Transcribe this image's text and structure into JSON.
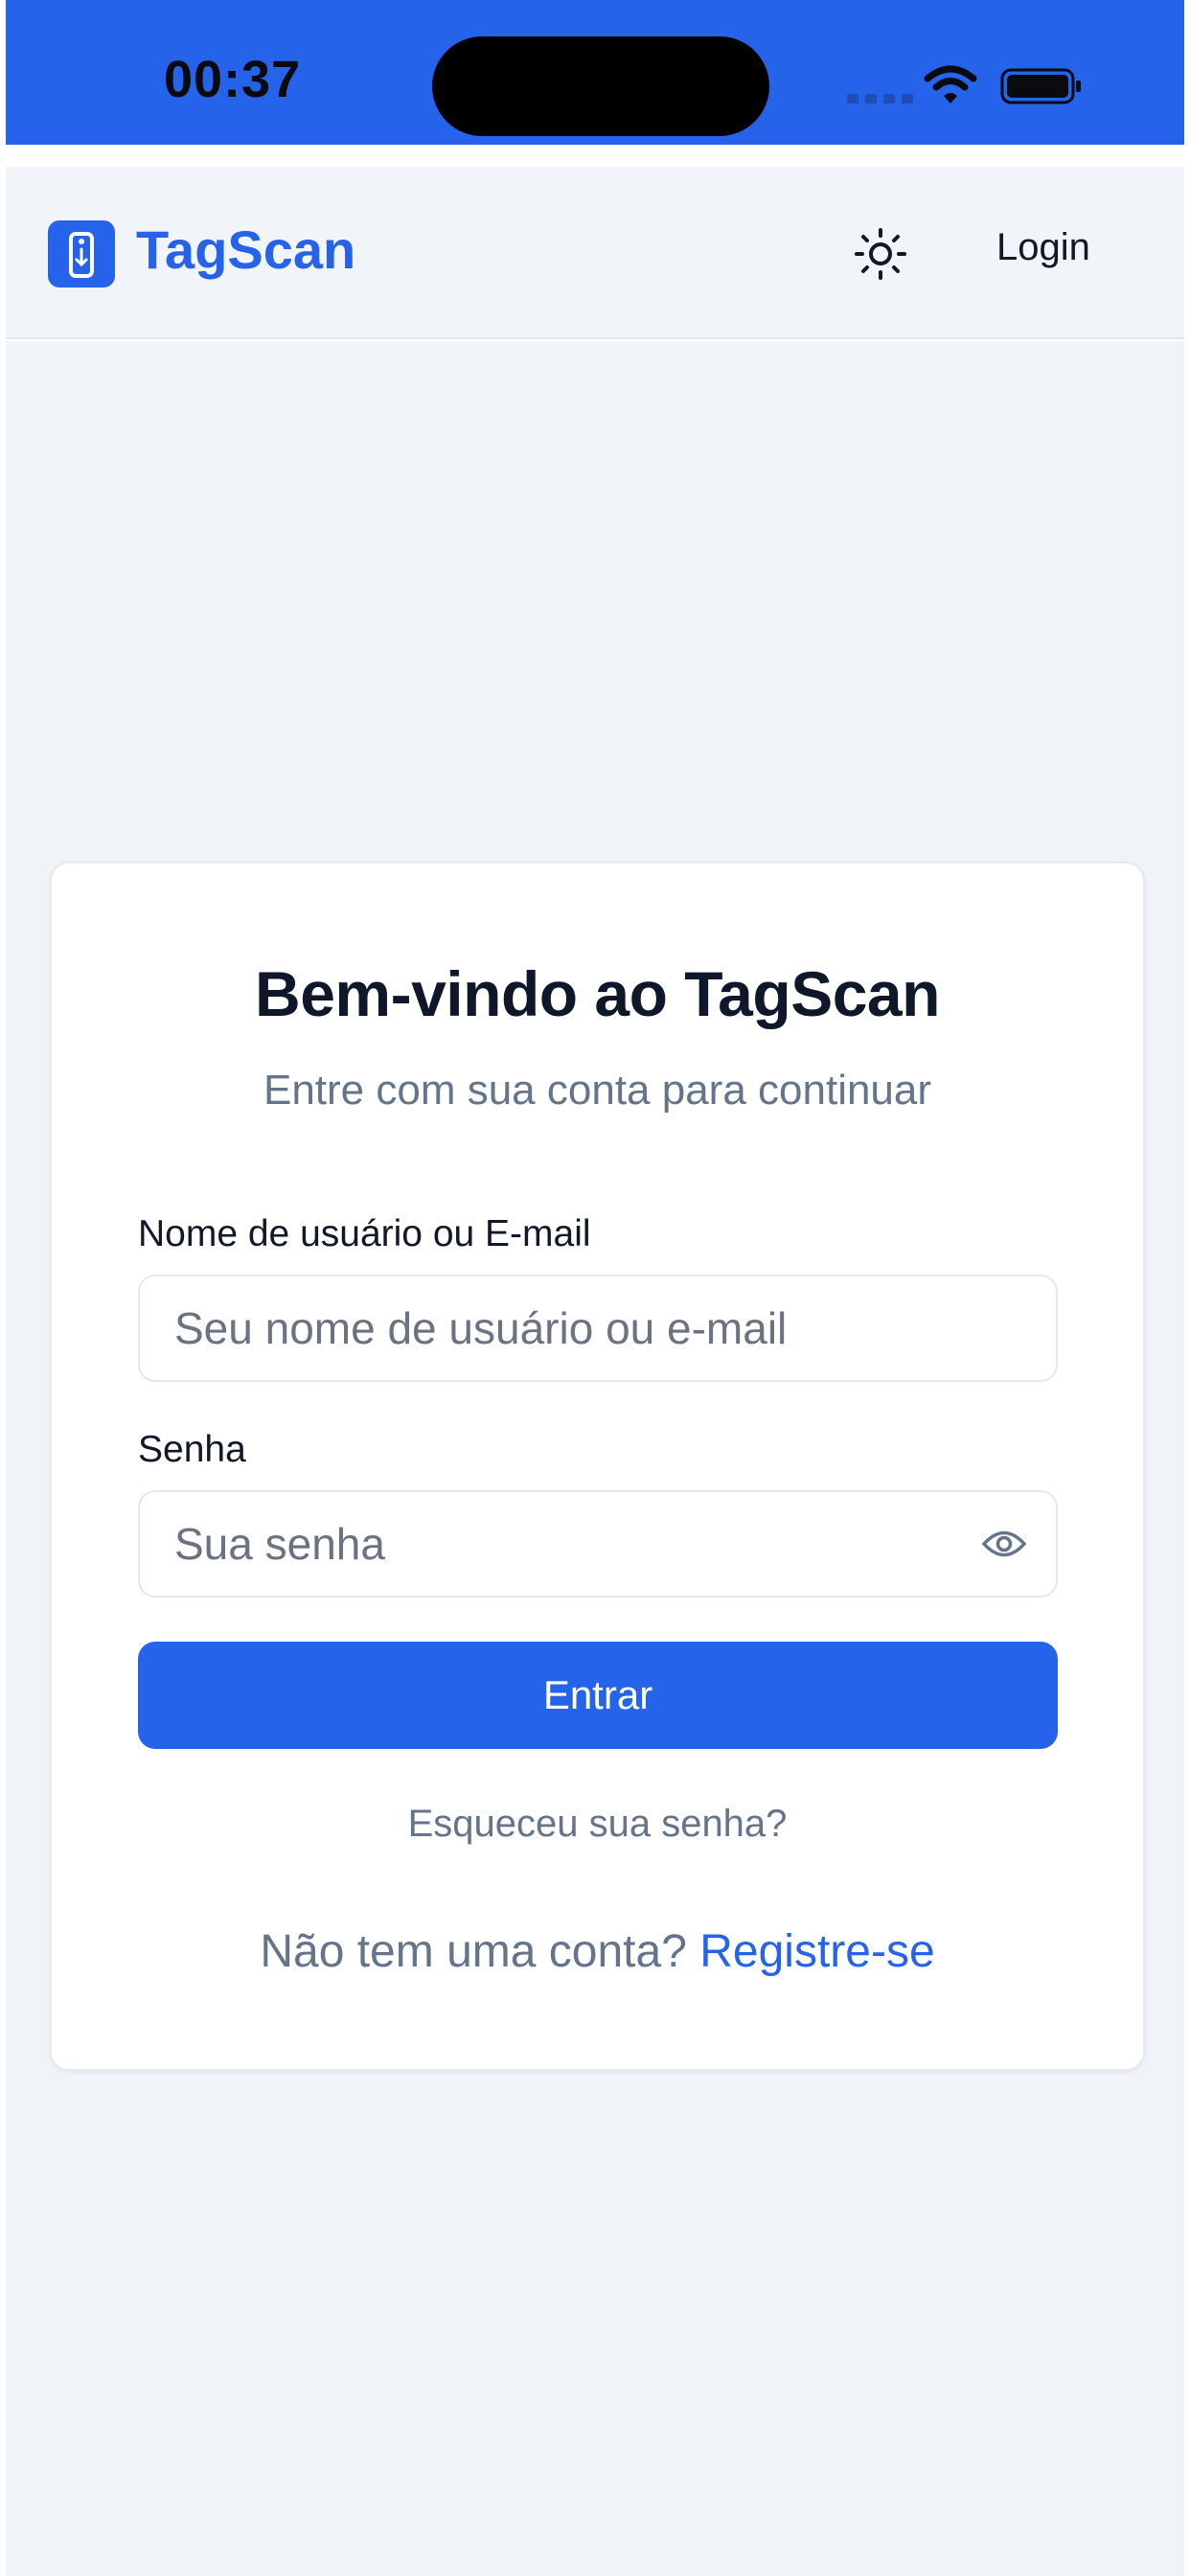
{
  "status_bar": {
    "time": "00:37"
  },
  "header": {
    "app_name": "TagScan",
    "logo_icon": "tag-icon",
    "theme_icon": "sun-icon",
    "login_label": "Login"
  },
  "login_card": {
    "title": "Bem-vindo ao TagScan",
    "subtitle": "Entre com sua conta para continuar",
    "username_label": "Nome de usuário ou E-mail",
    "username_placeholder": "Seu nome de usuário ou e-mail",
    "password_label": "Senha",
    "password_placeholder": "Sua senha",
    "password_toggle_icon": "eye-icon",
    "submit_label": "Entrar",
    "forgot_label": "Esqueceu sua senha?",
    "register_prompt": "Não tem uma conta? ",
    "register_label": "Registre-se"
  },
  "colors": {
    "primary": "#2563eb",
    "background": "#f0f3f8",
    "text_dark": "#0f172a",
    "text_muted": "#64748b"
  }
}
